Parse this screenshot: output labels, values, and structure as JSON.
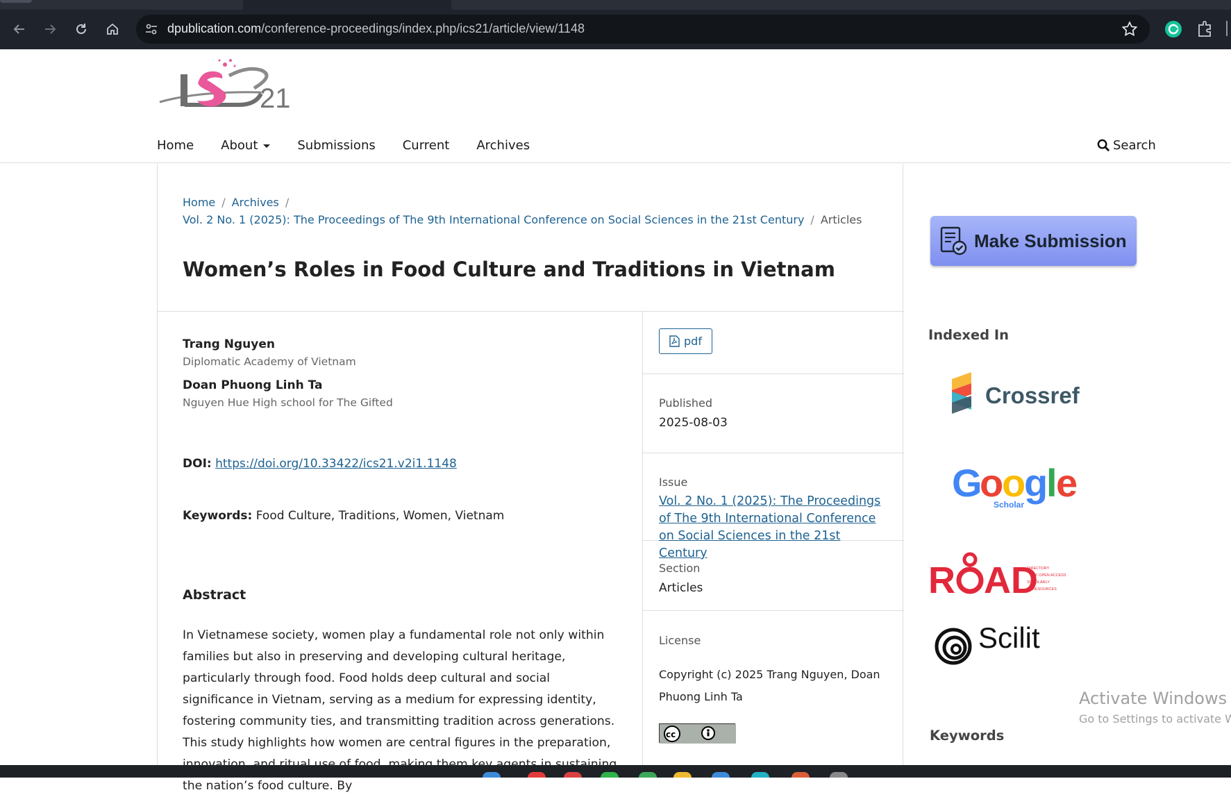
{
  "browser": {
    "url_domain": "dpublication.com",
    "url_path": "/conference-proceedings/index.php/ics21/article/view/1148"
  },
  "header": {
    "logo_text": "iCS21",
    "nav": [
      "Home",
      "About",
      "Submissions",
      "Current",
      "Archives"
    ],
    "search_label": "Search"
  },
  "breadcrumb": {
    "home": "Home",
    "archives": "Archives",
    "issue": "Vol. 2 No. 1 (2025): The Proceedings of The 9th International Conference on Social Sciences in the 21st Century",
    "current": "Articles"
  },
  "article": {
    "title": "Women’s Roles in Food Culture and Traditions in Vietnam",
    "authors": [
      {
        "name": "Trang Nguyen",
        "affiliation": "Diplomatic Academy of Vietnam"
      },
      {
        "name": "Doan Phuong Linh Ta",
        "affiliation": "Nguyen Hue High school for The Gifted"
      }
    ],
    "doi_label": "DOI:",
    "doi": "https://doi.org/10.33422/ics21.v2i1.1148",
    "keywords_label": "Keywords:",
    "keywords": "Food Culture, Traditions, Women, Vietnam",
    "abstract_heading": "Abstract",
    "abstract": "In Vietnamese society, women play a fundamental role not only within families but also in preserving and developing cultural heritage, particularly through food. Food holds deep cultural and social significance in Vietnam, serving as a medium for expressing identity, fostering community ties, and transmitting tradition across generations. This study highlights how women are central figures in the preparation, innovation, and ritual use of food, making them key agents in sustaining the nation’s food culture. By"
  },
  "details": {
    "pdf_label": "pdf",
    "published_label": "Published",
    "published": "2025-08-03",
    "issue_label": "Issue",
    "issue": "Vol. 2 No. 1 (2025): The Proceedings of The 9th International Conference on Social Sciences in the 21st Century",
    "section_label": "Section",
    "section": "Articles",
    "license_label": "License",
    "license": "Copyright (c) 2025 Trang Nguyen, Doan Phuong Linh Ta"
  },
  "sidebar": {
    "make_submission": "Make Submission",
    "indexed_in": "Indexed In",
    "crossref": "Crossref",
    "google": "Google",
    "google_sub": "Scholar",
    "road": "ROAD",
    "road_sub": [
      "DIRECTORY",
      "OF OPEN ACCESS",
      "SCHOLARLY",
      "RESOURCES"
    ],
    "scilit": "Scilit",
    "keywords": "Keywords"
  },
  "watermark": {
    "line1": "Activate Windows",
    "line2": "Go to Settings to activate W"
  },
  "colors": {
    "link": "#1e6292",
    "chrome_bg": "#1f232b",
    "submit_button": "#8f9ff4"
  }
}
